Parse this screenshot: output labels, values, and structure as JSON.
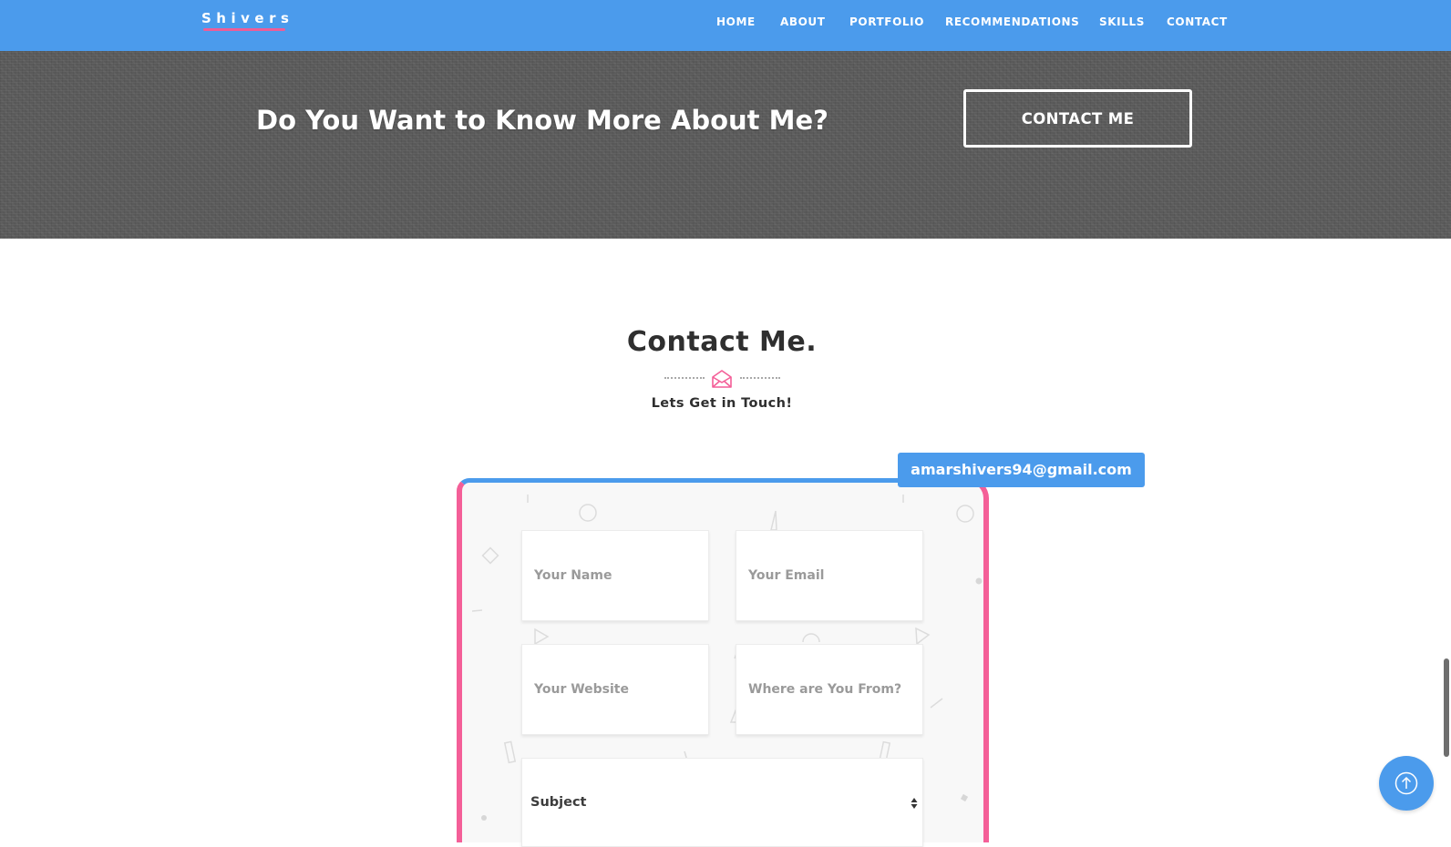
{
  "header": {
    "brand": "Shivers",
    "nav": [
      "HOME",
      "ABOUT",
      "PORTFOLIO",
      "RECOMMENDATIONS",
      "SKILLS",
      "CONTACT"
    ]
  },
  "hero": {
    "title": "Do You Want to Know More About Me?",
    "button_label": "CONTACT ME"
  },
  "contact": {
    "title": "Contact Me.",
    "subtitle": "Lets Get in Touch!",
    "email": "amarshivers94@gmail.com",
    "icon": "envelope-open-icon",
    "fields": {
      "name_placeholder": "Your Name",
      "email_placeholder": "Your Email",
      "website_placeholder": "Your Website",
      "from_placeholder": "Where are You From?",
      "subject_label": "Subject"
    }
  },
  "controls": {
    "scroll_top_icon": "arrow-up-circle-icon"
  },
  "colors": {
    "primary_blue": "#4b9bec",
    "accent_pink": "#f45f98",
    "heading_text": "#2f2f2f"
  }
}
